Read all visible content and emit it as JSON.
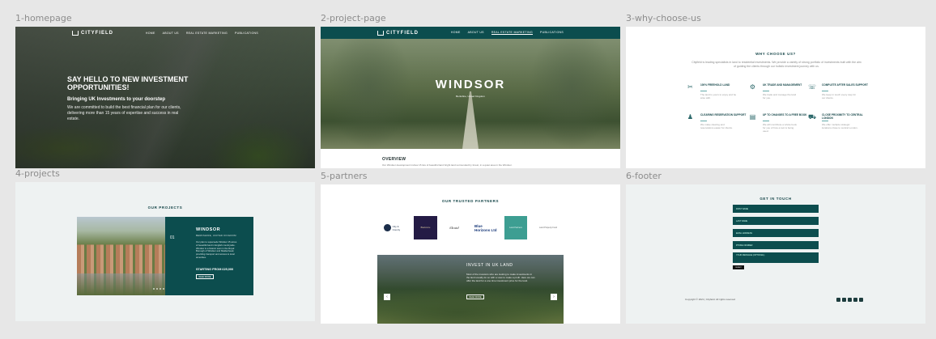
{
  "frames": {
    "f1": "1-homepage",
    "f2": "2-project-page",
    "f3": "3-why-choose-us",
    "f4": "4-projects",
    "f5": "5-partners",
    "f6": "6-footer"
  },
  "brand": {
    "name": "CITYFIELD"
  },
  "nav": {
    "home": "HOME",
    "about": "ABOUT US",
    "rem": "REAL ESTATE MARKETING",
    "pubs": "PUBLICATIONS"
  },
  "hero": {
    "title": "SAY HELLO TO NEW INVESTMENT OPPORTUNITIES!",
    "subtitle": "Bringing UK Investments to your doorstep",
    "text": "We are committed to build the best financial plan for our clients, delivering more than 15 years of expertise and success in real estate."
  },
  "project_page": {
    "title": "WINDSOR",
    "location": "Berkshire, United Kingdom",
    "overview_title": "OVERVIEW",
    "overview_text": "Our Windsor development invites 15 lots of beautiful land bright land surrounded by forest, in a quiet area in the Windsor."
  },
  "why": {
    "title": "WHY CHOOSE US?",
    "intro": "Cityfield is leading specialists in land to residential investments. We provide a variety of strong portfolio of investments built with the aim of guiding the clients through our holistic investment journey with us.",
    "features": [
      {
        "icon": "leaf-icon",
        "title": "100% FREEHOLD LAND",
        "desc": "The land is yours to enjoy and be wise with."
      },
      {
        "icon": "nodes-icon",
        "title": "UK TRADE AND MANAGEMENT",
        "desc": "We trade and manage the land for you."
      },
      {
        "icon": "phone-icon",
        "title": "COMPLETE AFTER SALES SUPPORT",
        "desc": "We keep in touch every step for our clients."
      },
      {
        "icon": "people-icon",
        "title": "CLEARING RESERVATION SUPPORT",
        "desc": "We make clearing and reservations easier for clients."
      },
      {
        "icon": "document-icon",
        "title": "UP TO CHANGES TO A FREE BOOK",
        "desc": "We will contribute a whole book for you of how a tool is being used."
      },
      {
        "icon": "car-icon",
        "title": "CLOSE PROXIMITY TO CENTRAL LONDON",
        "desc": "We offer multiple strategic locations close to central London."
      }
    ]
  },
  "projects": {
    "title": "OUR PROJECTS",
    "number": "01",
    "name": "WINDSOR",
    "subtitle": "BERKSHIRE, UNITED KINGDOM",
    "desc": "Our plan to supersede Windsor 15 acres of beautiful land in English countryside. Windsor is a historic town in the Royal Borough of Windsor and Maidenhead, providing transport and access to local amenities.",
    "price": "STARTING FROM £25,000",
    "button": "READ MORE"
  },
  "partners": {
    "title": "OUR TRUSTED PARTNERS",
    "logos": [
      "City & County",
      "Blackmore",
      "Sbuid",
      "Blue Horizons Ltd",
      "Land Partners",
      "Land Property Fund"
    ],
    "invest_title": "INVEST IN UK LAND",
    "invest_text": "Most of the investors who are looking to make investments in the land usually do so with a view to make a profit. Here we can offer the land for a one time investment price for the land.",
    "invest_button": "READ MORE"
  },
  "footer": {
    "title": "GET IN TOUCH",
    "fields": [
      "FIRST NAME",
      "LAST NAME",
      "EMAIL ADDRESS",
      "PHONE NUMBER",
      "YOUR MESSAGE (OPTIONAL)"
    ],
    "submit": "SUBMIT",
    "copyright": "Copyright © 2021 | Cityfield. All rights reserved"
  },
  "colors": {
    "primary": "#0c4d4e",
    "background": "#e7e7e7"
  }
}
